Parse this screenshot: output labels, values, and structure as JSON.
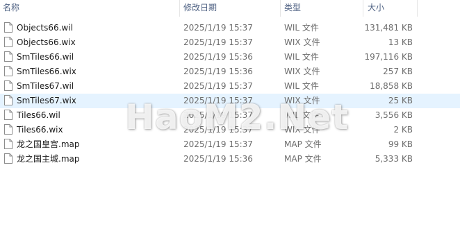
{
  "columns": {
    "name": "名称",
    "date": "修改日期",
    "type": "类型",
    "size": "大小"
  },
  "files": [
    {
      "name": "Objects66.wil",
      "date": "2025/1/19 15:37",
      "type": "WIL 文件",
      "size": "131,481 KB",
      "icon": "file-icon"
    },
    {
      "name": "Objects66.wix",
      "date": "2025/1/19 15:37",
      "type": "WIX 文件",
      "size": "13 KB",
      "icon": "file-icon"
    },
    {
      "name": "SmTiles66.wil",
      "date": "2025/1/19 15:36",
      "type": "WIL 文件",
      "size": "197,116 KB",
      "icon": "file-icon"
    },
    {
      "name": "SmTiles66.wix",
      "date": "2025/1/19 15:36",
      "type": "WIX 文件",
      "size": "257 KB",
      "icon": "file-icon"
    },
    {
      "name": "SmTiles67.wil",
      "date": "2025/1/19 15:37",
      "type": "WIL 文件",
      "size": "18,858 KB",
      "icon": "file-icon"
    },
    {
      "name": "SmTiles67.wix",
      "date": "2025/1/19 15:37",
      "type": "WIX 文件",
      "size": "25 KB",
      "icon": "file-icon"
    },
    {
      "name": "Tiles66.wil",
      "date": "2025/1/19 15:37",
      "type": "WIL 文件",
      "size": "3,556 KB",
      "icon": "file-icon"
    },
    {
      "name": "Tiles66.wix",
      "date": "2025/1/19 15:37",
      "type": "WIX 文件",
      "size": "2 KB",
      "icon": "file-icon"
    },
    {
      "name": "龙之国皇宫.map",
      "date": "2025/1/19 15:37",
      "type": "MAP 文件",
      "size": "99 KB",
      "icon": "file-icon"
    },
    {
      "name": "龙之国主城.map",
      "date": "2025/1/19 15:36",
      "type": "MAP 文件",
      "size": "5,333 KB",
      "icon": "file-icon"
    }
  ],
  "hover_row_index": 5,
  "watermark": "HaoM2.Net",
  "colors": {
    "header_text": "#4d6082",
    "detail_text": "#6d6d6d",
    "hover_bg": "#e5f3ff"
  }
}
